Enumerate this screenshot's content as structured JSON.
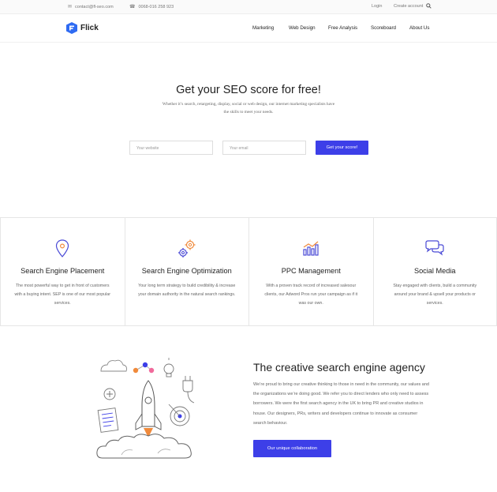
{
  "topbar": {
    "email": "contact@fl-seo.com",
    "phone": "0068-016 258 923",
    "login": "Login",
    "create_account": "Create account"
  },
  "header": {
    "logo": "Flick",
    "nav": [
      "Marketing",
      "Web Design",
      "Free Analysis",
      "Scoreboard",
      "About Us"
    ]
  },
  "hero": {
    "title": "Get your SEO score for free!",
    "subtitle": "Whether it’s search, retargeting, display, social or web design, our internet marketing specialists have the skills to meet your needs.",
    "website_placeholder": "Your website",
    "email_placeholder": "Your email",
    "cta": "Get your score!"
  },
  "services": [
    {
      "title": "Search Engine Placement",
      "desc": "The most powerful way to get in front of customers with a buying intent. SEP is one of our most popular services.",
      "icon": "map-pin-icon"
    },
    {
      "title": "Search Engine Optimization",
      "desc": "Your long term strategy to build credibility & increase your domain authority in the natural search rankings.",
      "icon": "gears-icon"
    },
    {
      "title": "PPC Management",
      "desc": "With a proven track record of increased salesour clients, our Adword Pros run your campaign as if it was our own.",
      "icon": "bar-chart-icon"
    },
    {
      "title": "Social Media",
      "desc": "Stay engaged with clients, build a community around your brand & upsell your products or services.",
      "icon": "chat-bubbles-icon"
    }
  ],
  "agency": {
    "title": "The creative search engine agency",
    "text": "We’re proud to bring our creative thinking to those in need in the community, our values and the organizations we’re doing good. We refer you to direct lenders who only need to assess borrowers. We were the first search agency in the UK to bring PR and creative studios in house. Our designers, PRs, writers and developers continue to innovate as consumer search behaviour.",
    "button": "Our unique collaboration"
  },
  "colors": {
    "accent": "#3d3fe8",
    "text": "#222222",
    "muted": "#666666"
  }
}
